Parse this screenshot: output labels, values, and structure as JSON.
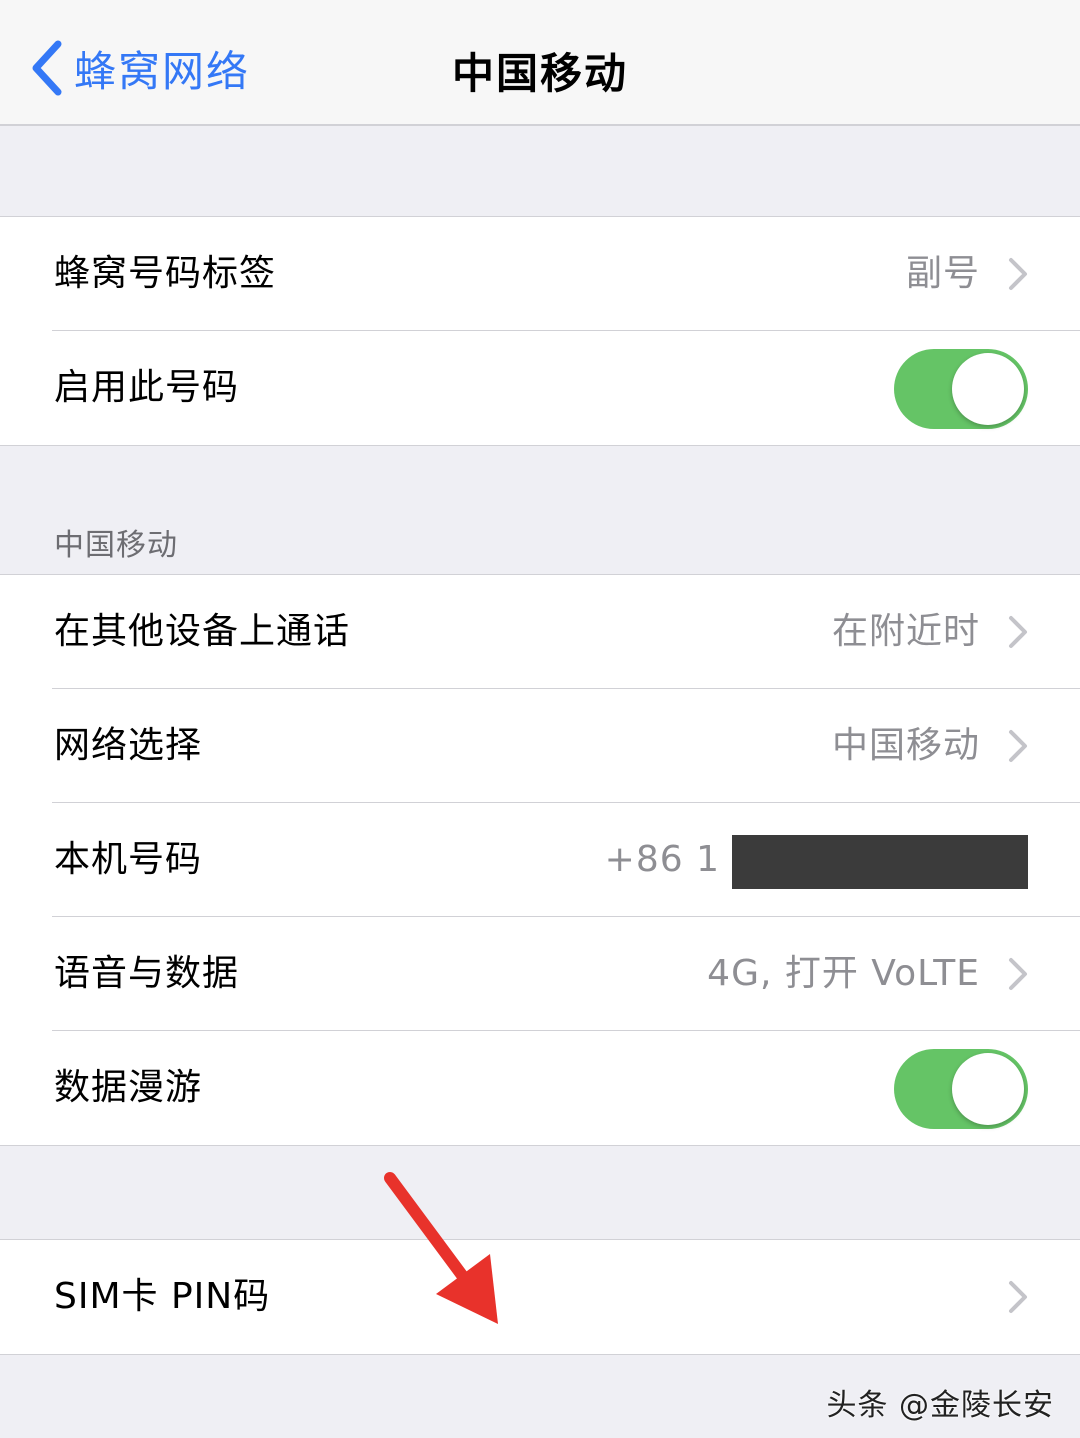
{
  "navbar": {
    "back_label": "蜂窝网络",
    "title": "中国移动"
  },
  "group1": {
    "number_label": {
      "label": "蜂窝号码标签",
      "value": "副号"
    },
    "enable_line": {
      "label": "启用此号码",
      "on": true
    }
  },
  "section_header": "中国移动",
  "group2": {
    "calls_other_devices": {
      "label": "在其他设备上通话",
      "value": "在附近时"
    },
    "network_selection": {
      "label": "网络选择",
      "value": "中国移动"
    },
    "my_number": {
      "label": "本机号码",
      "value": "+86 1"
    },
    "voice_data": {
      "label": "语音与数据",
      "value": "4G, 打开 VoLTE"
    },
    "data_roaming": {
      "label": "数据漫游",
      "on": true
    }
  },
  "group3": {
    "sim_pin": {
      "label": "SIM卡 PIN码"
    }
  },
  "watermark": "头条 @金陵长安",
  "colors": {
    "accent": "#3478f6",
    "toggle_on": "#65c466",
    "arrow": "#e8322b"
  }
}
